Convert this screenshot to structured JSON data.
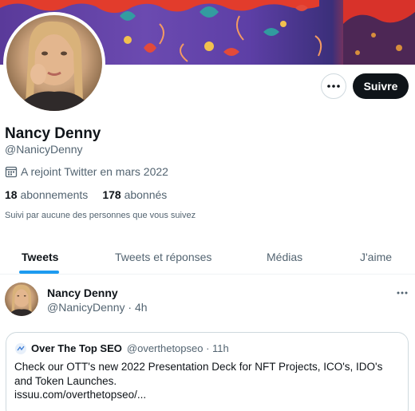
{
  "profile": {
    "name": "Nancy Denny",
    "handle": "@NanicyDenny",
    "joined": "A rejoint Twitter en mars 2022",
    "following_count": "18",
    "following_label": "abonnements",
    "followers_count": "178",
    "followers_label": "abonnés",
    "followed_by": "Suivi par aucune des personnes que vous suivez"
  },
  "actions": {
    "more_icon": "more-horizontal-icon",
    "follow_label": "Suivre"
  },
  "tabs": [
    {
      "label": "Tweets",
      "active": true
    },
    {
      "label": "Tweets et réponses",
      "active": false
    },
    {
      "label": "Médias",
      "active": false
    },
    {
      "label": "J'aime",
      "active": false
    }
  ],
  "tweet": {
    "author": "Nancy Denny",
    "handle": "@NanicyDenny",
    "time": "4h",
    "quote": {
      "author": "Over The Top SEO",
      "handle": "@overthetopseo",
      "time": "11h",
      "text": "Check our OTT's new 2022 Presentation Deck for NFT Projects, ICO's, IDO's and Token Launches.",
      "link": "issuu.com/overthetopseo/..."
    }
  },
  "colors": {
    "accent": "#1d9bf0",
    "text_primary": "#0f1419",
    "text_secondary": "#536471",
    "button_dark": "#0f1419"
  }
}
